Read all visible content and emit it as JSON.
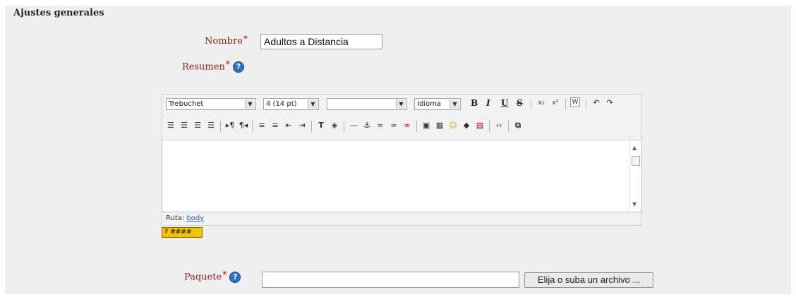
{
  "fieldset": {
    "legend": "Ajustes generales"
  },
  "form": {
    "nombre": {
      "label": "Nombre",
      "required_mark": "*",
      "value": "Adultos a Distancia"
    },
    "resumen": {
      "label": "Resumen",
      "required_mark": "*",
      "help_icon": "help-icon"
    },
    "paquete": {
      "label": "Paquete",
      "required_mark": "*",
      "help_icon": "help-icon",
      "value": "",
      "button_label": "Elija o suba un archivo ..."
    }
  },
  "editor": {
    "font_select": "Trebuchet",
    "size_select": "4 (14 pt)",
    "style_select": "",
    "lang_select": "Idioma",
    "status_label": "Ruta:",
    "status_path": "body",
    "keyboard_help": "? ####"
  },
  "colors": {
    "label": "#8a1e1e",
    "required": "#cc0000",
    "help": "#2a6fc9",
    "fieldset_bg": "#efefef"
  }
}
